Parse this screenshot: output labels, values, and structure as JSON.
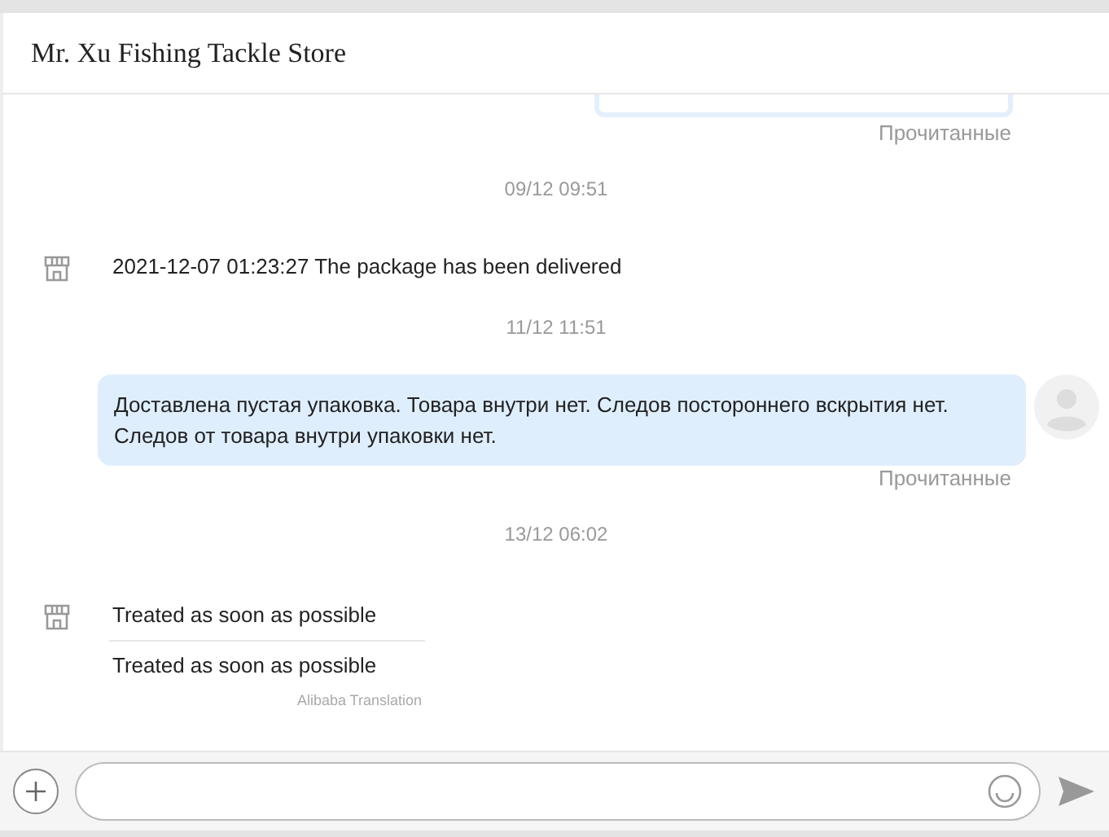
{
  "window": {
    "title": "Mr. Xu Fishing Tackle Store"
  },
  "messages": [
    {
      "kind": "clipped",
      "status": "Прочитанные"
    },
    {
      "kind": "date",
      "text": "09/12 09:51"
    },
    {
      "kind": "store",
      "text": "2021-12-07 01:23:27 The package has been delivered"
    },
    {
      "kind": "date",
      "text": "11/12 11:51"
    },
    {
      "kind": "outgoing",
      "text": "Доставлена пустая упаковка. Товара внутри нет. Следов постороннего вскрытия нет. Следов от товара внутри упаковки нет.",
      "status": "Прочитанные"
    },
    {
      "kind": "date",
      "text": "13/12 06:02"
    },
    {
      "kind": "translated",
      "text": "Treated as soon as possible",
      "translation": "Treated as soon as possible",
      "source": "Alibaba Translation"
    }
  ]
}
